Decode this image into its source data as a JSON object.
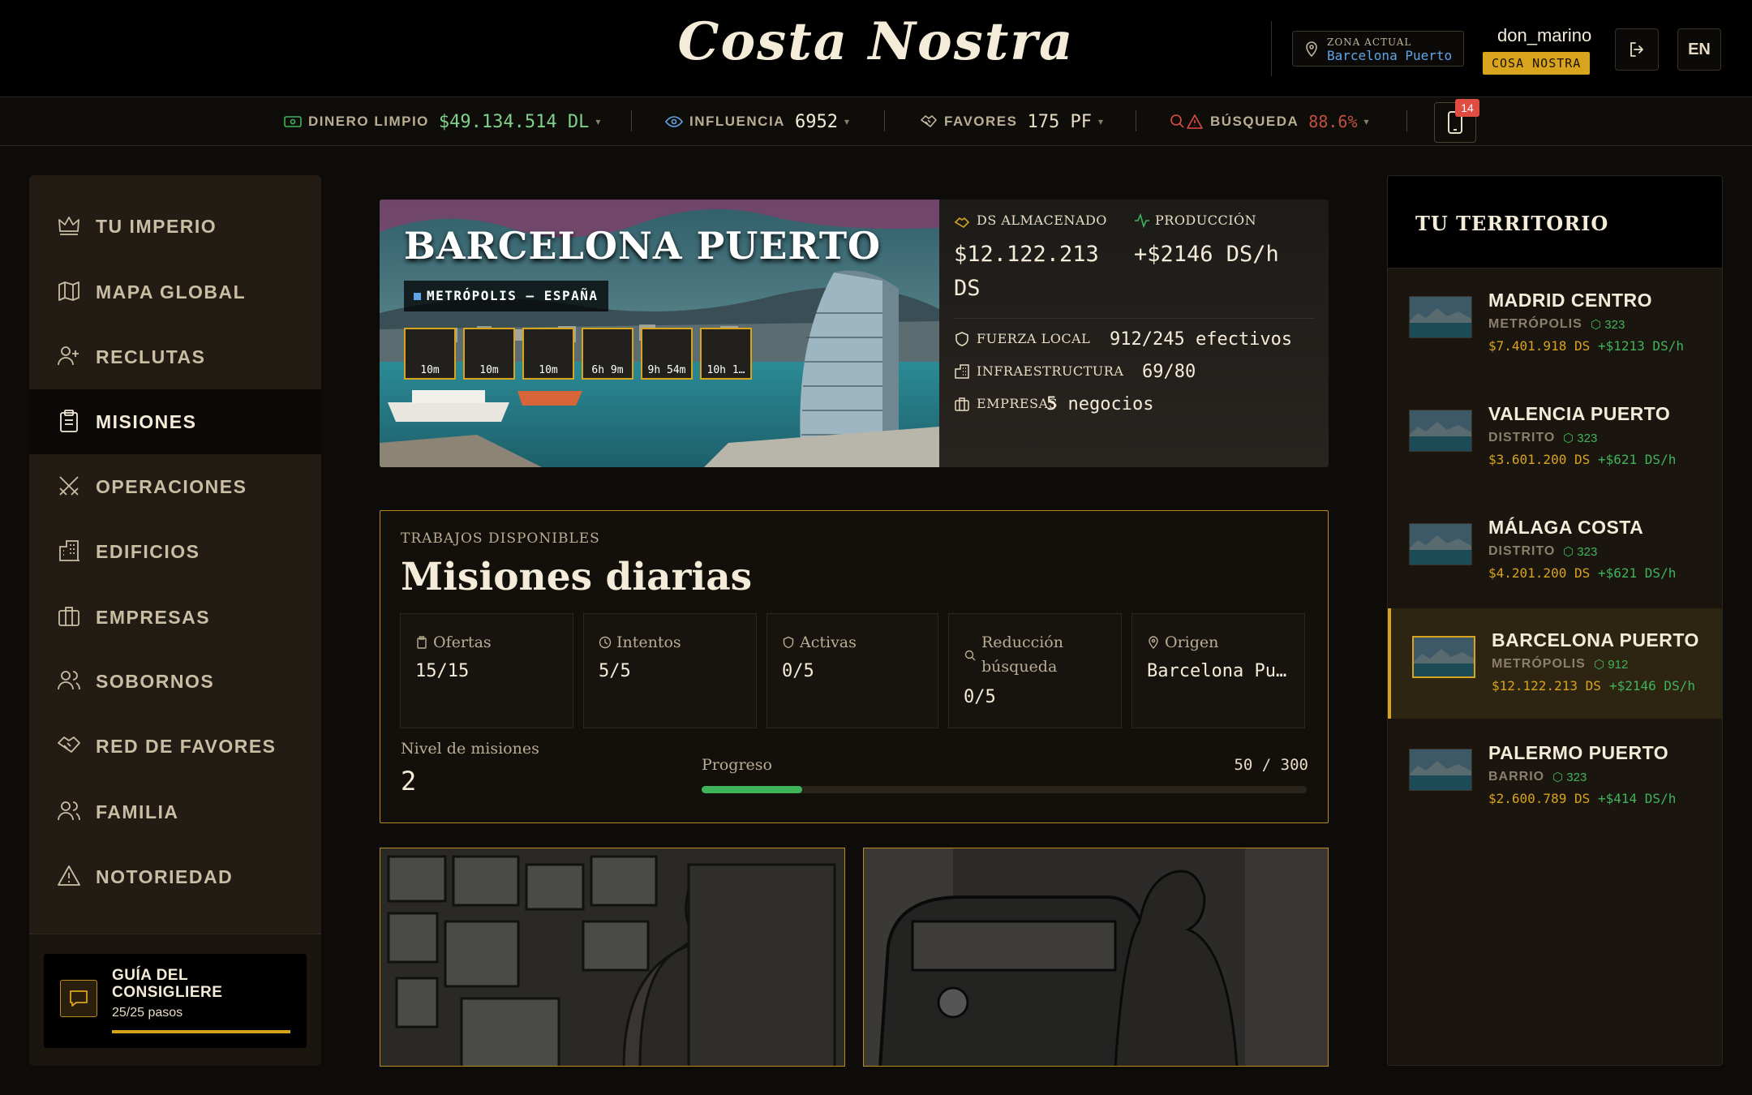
{
  "header": {
    "logo": "Costa Nostra",
    "zone_label": "ZONA ACTUAL",
    "zone_value": "Barcelona Puerto",
    "username": "don_marino",
    "faction": "COSA NOSTRA",
    "lang": "EN"
  },
  "resources": {
    "clean_money": {
      "label": "DINERO LIMPIO",
      "value": "$49.134.514 DL"
    },
    "influence": {
      "label": "INFLUENCIA",
      "value": "6952"
    },
    "favors": {
      "label": "FAVORES",
      "value": "175 PF"
    },
    "search": {
      "label": "BÚSQUEDA",
      "value": "88.6%"
    },
    "notifications": "14"
  },
  "sidebar": {
    "items": [
      {
        "label": "TU IMPERIO",
        "icon": "crown-icon"
      },
      {
        "label": "MAPA GLOBAL",
        "icon": "map-icon"
      },
      {
        "label": "RECLUTAS",
        "icon": "user-plus-icon"
      },
      {
        "label": "MISIONES",
        "icon": "clipboard-icon",
        "active": true
      },
      {
        "label": "OPERACIONES",
        "icon": "crossed-swords-icon"
      },
      {
        "label": "EDIFICIOS",
        "icon": "buildings-icon"
      },
      {
        "label": "EMPRESAS",
        "icon": "briefcase-icon"
      },
      {
        "label": "SOBORNOS",
        "icon": "users-icon"
      },
      {
        "label": "RED DE FAVORES",
        "icon": "handshake-icon"
      },
      {
        "label": "FAMILIA",
        "icon": "family-icon"
      },
      {
        "label": "NOTORIEDAD",
        "icon": "warning-icon"
      }
    ],
    "guide": {
      "title": "GUÍA DEL CONSIGLIERE",
      "steps": "25/25 pasos",
      "progress": 1.0
    }
  },
  "city": {
    "name": "BARCELONA PUERTO",
    "tag": "METRÓPOLIS — ESPAÑA",
    "timers": [
      "10m",
      "10m",
      "10m",
      "6h 9m",
      "9h 54m",
      "10h 1…"
    ],
    "stored_label": "DS ALMACENADO",
    "stored_value": "$12.122.213",
    "stored_unit": "DS",
    "production_label": "PRODUCCIÓN",
    "production_value": "+$2146 DS/h",
    "force_label": "FUERZA LOCAL",
    "force_value": "912/245 efectivos",
    "infra_label": "INFRAESTRUCTURA",
    "infra_value": "69/80",
    "biz_label": "EMPRESAS",
    "biz_value": "5 negocios"
  },
  "missions": {
    "kicker": "TRABAJOS DISPONIBLES",
    "title": "Misiones diarias",
    "stats": [
      {
        "label": "Ofertas",
        "value": "15/15",
        "icon": "clipboard-icon"
      },
      {
        "label": "Intentos",
        "value": "5/5",
        "icon": "clock-icon"
      },
      {
        "label": "Activas",
        "value": "0/5",
        "icon": "shield-icon"
      },
      {
        "label": "Reducción búsqueda",
        "value": "0/5",
        "icon": "search-icon"
      },
      {
        "label": "Origen",
        "value": "Barcelona Pu…",
        "icon": "pin-icon"
      }
    ],
    "level_label": "Nivel de misiones",
    "level": "2",
    "progress_label": "Progreso",
    "progress_text": "50 / 300",
    "progress": 0.1667
  },
  "territory": {
    "title": "TU TERRITORIO",
    "items": [
      {
        "name": "MADRID CENTRO",
        "type": "METRÓPOLIS",
        "shield": "323",
        "money": "$7.401.918 DS",
        "prod": "+$1213 DS/h"
      },
      {
        "name": "VALENCIA PUERTO",
        "type": "DISTRITO",
        "shield": "323",
        "money": "$3.601.200 DS",
        "prod": "+$621 DS/h"
      },
      {
        "name": "MÁLAGA COSTA",
        "type": "DISTRITO",
        "shield": "323",
        "money": "$4.201.200 DS",
        "prod": "+$621 DS/h"
      },
      {
        "name": "BARCELONA PUERTO",
        "type": "METRÓPOLIS",
        "shield": "912",
        "money": "$12.122.213 DS",
        "prod": "+$2146 DS/h",
        "active": true
      },
      {
        "name": "PALERMO PUERTO",
        "type": "BARRIO",
        "shield": "323",
        "money": "$2.600.789 DS",
        "prod": "+$414 DS/h"
      }
    ]
  },
  "colors": {
    "accent": "#d9a41d",
    "positive": "#3fb45a",
    "danger": "#e04b42",
    "info": "#5fa5e6"
  }
}
